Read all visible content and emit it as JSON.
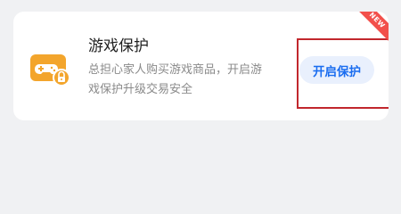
{
  "card": {
    "title": "游戏保护",
    "description_line1": "总担心家人购买游戏商品，开启游",
    "description_line2": "戏保护升级交易安全",
    "action_label": "开启保护",
    "badge": "NEW"
  },
  "icons": {
    "app": "gamepad-lock-icon"
  },
  "colors": {
    "icon_orange": "#f3a52c",
    "button_bg": "#e9f0fd",
    "button_text": "#1a6df0",
    "highlight": "#c1272d",
    "badge_bg": "#f2504b"
  }
}
